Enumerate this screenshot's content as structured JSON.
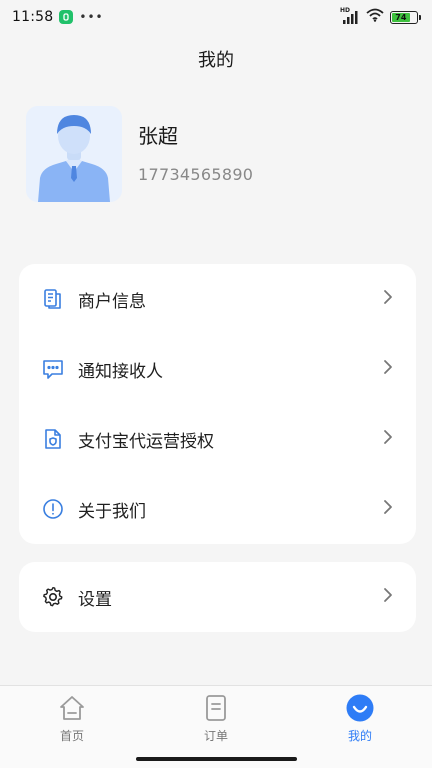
{
  "status_bar": {
    "time": "11:58",
    "battery_level": "74",
    "network_label": "HD"
  },
  "header": {
    "title": "我的"
  },
  "profile": {
    "name": "张超",
    "phone": "17734565890"
  },
  "menu": {
    "items": [
      {
        "label": "商户信息",
        "icon": "merchant-doc-icon"
      },
      {
        "label": "通知接收人",
        "icon": "message-icon"
      },
      {
        "label": "支付宝代运营授权",
        "icon": "authorization-doc-icon"
      },
      {
        "label": "关于我们",
        "icon": "info-icon"
      }
    ],
    "settings": {
      "label": "设置",
      "icon": "gear-icon"
    }
  },
  "tab_bar": {
    "tabs": [
      {
        "label": "首页",
        "icon": "home-icon"
      },
      {
        "label": "订单",
        "icon": "order-icon"
      },
      {
        "label": "我的",
        "icon": "profile-smile-icon",
        "active": true
      }
    ]
  },
  "colors": {
    "accent": "#2e7cf6",
    "icon_blue": "#3a7fe0",
    "background": "#f5f5f5",
    "battery": "#3ec13e"
  }
}
